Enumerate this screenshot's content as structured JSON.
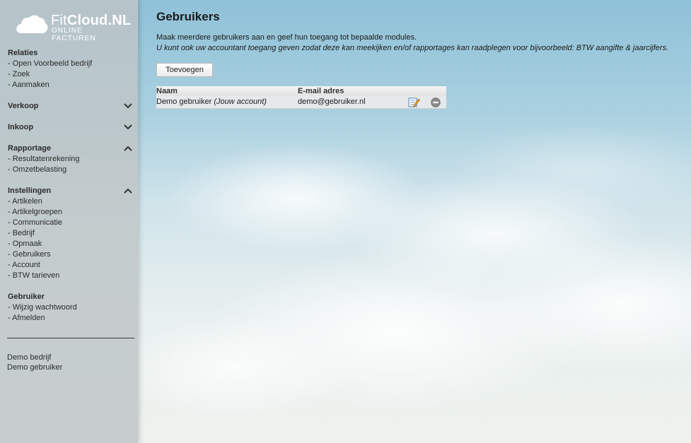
{
  "logo": {
    "brand_a": "Fit",
    "brand_b": "Cloud.NL",
    "tagline": "ONLINE FACTUREN"
  },
  "sidebar": {
    "sections": [
      {
        "title": "Relaties",
        "expanded": true,
        "items": [
          "- Open Voorbeeld bedrijf",
          "- Zoek",
          "- Aanmaken"
        ]
      },
      {
        "title": "Verkoop",
        "expanded": false,
        "items": []
      },
      {
        "title": "Inkoop",
        "expanded": false,
        "items": []
      },
      {
        "title": "Rapportage",
        "expanded": true,
        "items": [
          "- Resultatenrekening",
          "- Omzetbelasting"
        ]
      },
      {
        "title": "Instellingen",
        "expanded": true,
        "items": [
          "- Artikelen",
          "- Artikelgroepen",
          "- Communicatie",
          "- Bedrijf",
          "- Opmaak",
          "- Gebruikers",
          "- Account",
          "- BTW tarieven"
        ]
      },
      {
        "title": "Gebruiker",
        "expanded": true,
        "items": [
          "- Wijzig wachtwoord",
          "- Afmelden"
        ]
      }
    ],
    "footer": {
      "company": "Demo bedrijf",
      "user": "Demo gebruiker"
    }
  },
  "main": {
    "title": "Gebruikers",
    "intro_line1": "Maak meerdere gebruikers aan en geef hun toegang tot bepaalde modules.",
    "intro_line2": "U kunt ook uw accountant toegang geven zodat deze kan meekijken en/of rapportages kan raadplegen voor bijvoorbeeld: BTW aangifte & jaarcijfers.",
    "add_button": "Toevoegen",
    "table": {
      "headers": {
        "name": "Naam",
        "email": "E-mail adres"
      },
      "rows": [
        {
          "name": "Demo gebruiker",
          "name_note": "(Jouw account)",
          "email": "demo@gebruiker.nl"
        }
      ]
    }
  },
  "icons": {
    "edit": "edit-icon",
    "delete": "delete-icon",
    "expand": "chevron-down-icon",
    "collapse": "chevron-up-icon"
  }
}
